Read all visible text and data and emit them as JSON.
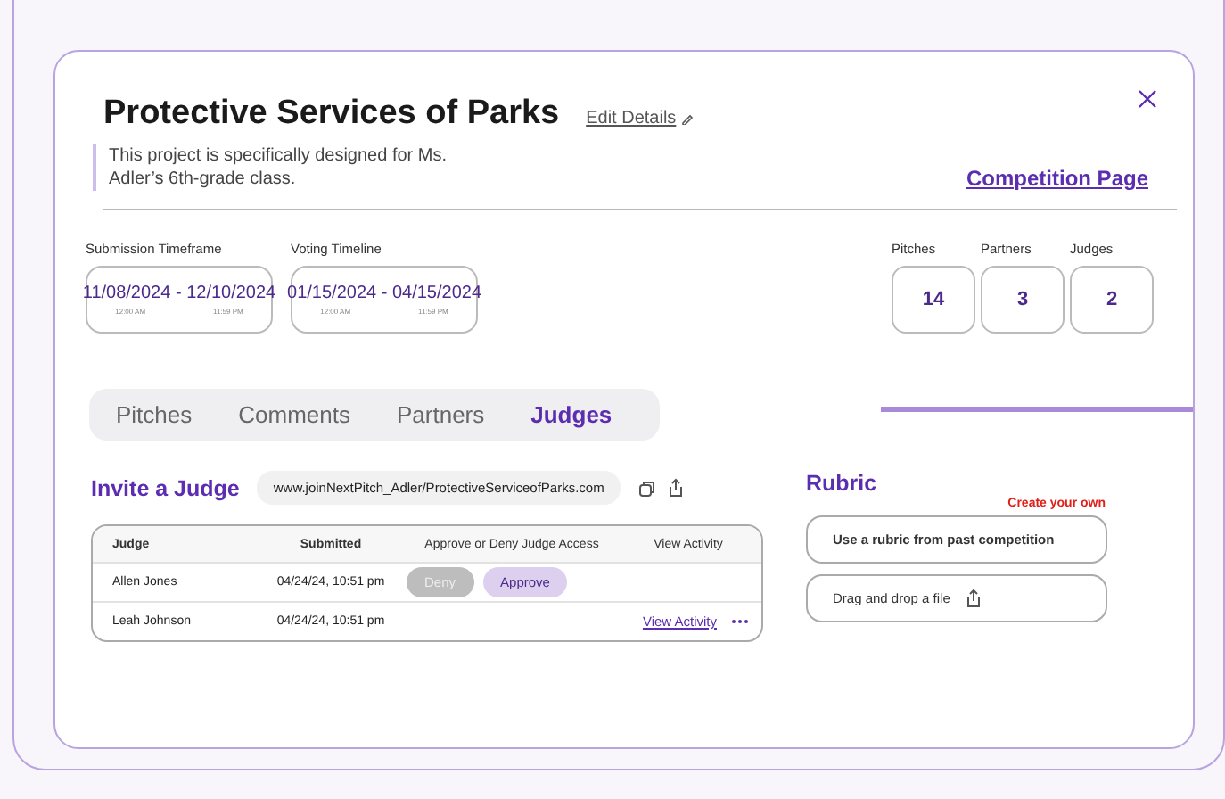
{
  "title": "Protective Services of Parks",
  "edit_link": "Edit Details",
  "description": "This project is specifically designed for Ms. Adler’s 6th-grade class.",
  "competition_link": "Competition Page",
  "timeframes": [
    {
      "label": "Submission Timeframe",
      "dates": "11/08/2024 - 12/10/2024",
      "start_time": "12:00 AM",
      "end_time": "11:59 PM"
    },
    {
      "label": "Voting Timeline",
      "dates": "01/15/2024 - 04/15/2024",
      "start_time": "12:00 AM",
      "end_time": "11:59 PM"
    }
  ],
  "stats": [
    {
      "label": "Pitches",
      "value": "14"
    },
    {
      "label": "Partners",
      "value": "3"
    },
    {
      "label": "Judges",
      "value": "2"
    }
  ],
  "tabs": [
    {
      "label": "Pitches",
      "selected": false
    },
    {
      "label": "Comments",
      "selected": false
    },
    {
      "label": "Partners",
      "selected": false
    },
    {
      "label": "Judges",
      "selected": true
    }
  ],
  "invite": {
    "title": "Invite a Judge",
    "link": "www.joinNextPitch_Adler/ProtectiveServiceofParks.com"
  },
  "judges_table": {
    "columns": [
      "Judge",
      "Submitted",
      "Approve or Deny Judge Access",
      "View Activity"
    ],
    "rows": [
      {
        "kind": "pending",
        "judge": "Allen Jones",
        "submitted": "04/24/24, 10:51 pm",
        "deny": "Deny",
        "approve": "Approve"
      },
      {
        "kind": "active",
        "judge": "Leah Johnson",
        "submitted": "04/24/24, 10:51 pm",
        "view_activity": "View Activity"
      }
    ]
  },
  "rubric": {
    "title": "Rubric",
    "create_link": "Create your own",
    "options": [
      {
        "kind": "choice",
        "label": "Use a rubric from past competition"
      },
      {
        "kind": "upload",
        "label": "Drag and drop a file"
      }
    ]
  }
}
